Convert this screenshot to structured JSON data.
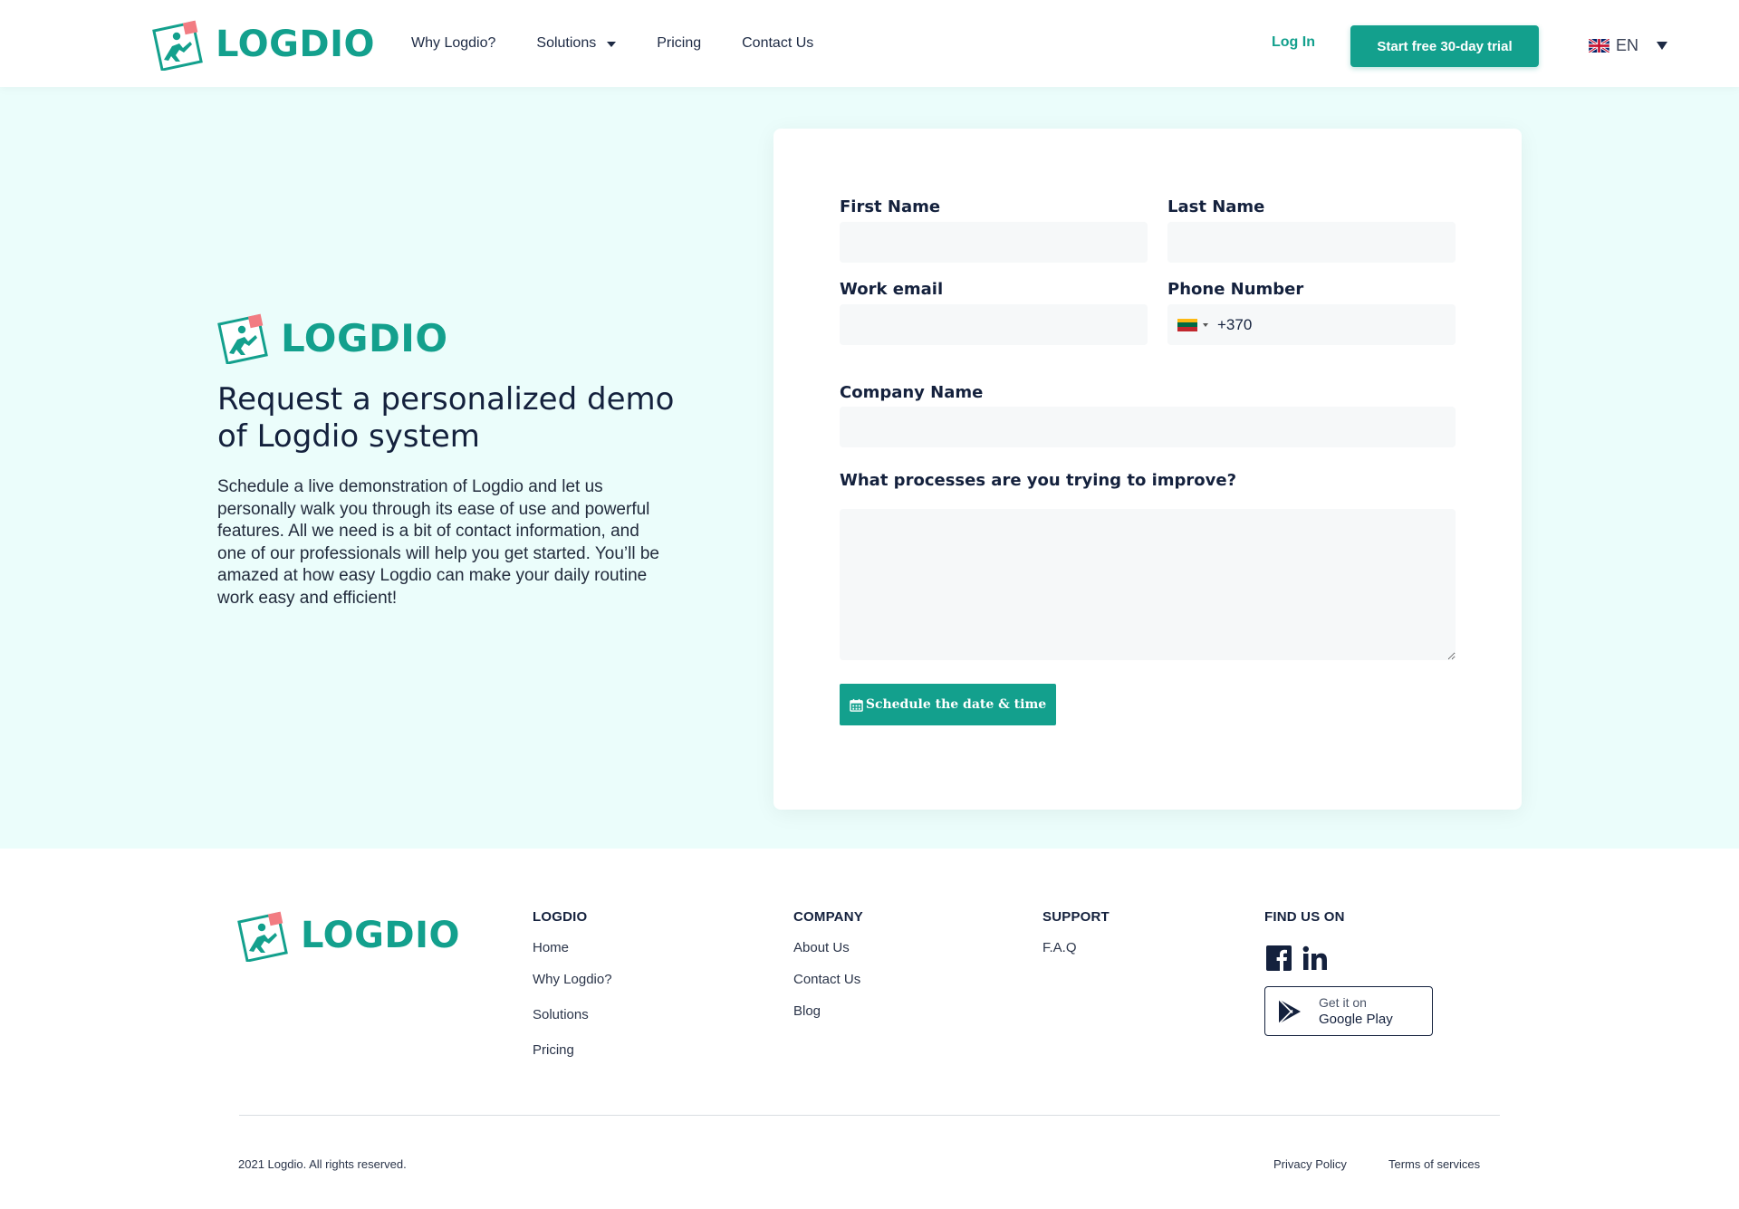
{
  "brand": {
    "name": "LOGDIO",
    "color": "#13a08d",
    "accent_color": "#f27c82"
  },
  "header": {
    "nav": [
      {
        "label": "Why Logdio?",
        "has_dropdown": false
      },
      {
        "label": "Solutions",
        "has_dropdown": true
      },
      {
        "label": "Pricing",
        "has_dropdown": false
      },
      {
        "label": "Contact Us",
        "has_dropdown": false
      }
    ],
    "login_label": "Log In",
    "trial_label": "Start free 30-day trial",
    "language": {
      "code": "EN",
      "flag_icon": "uk-flag-icon"
    }
  },
  "hero": {
    "title": "Request a personalized demo of Logdio system",
    "description": "Schedule a live demonstration of Logdio and let us personally walk you through its ease of use and powerful features. All we need is a bit of contact information, and one of our professionals will help you get started. You’ll be amazed at how easy Logdio can make your daily routine work easy and efficient!"
  },
  "form": {
    "first_name": {
      "label": "First Name",
      "value": ""
    },
    "last_name": {
      "label": "Last Name",
      "value": ""
    },
    "work_email": {
      "label": "Work email",
      "value": ""
    },
    "phone": {
      "label": "Phone Number",
      "value": "+370",
      "country_flag_icon": "lithuania-flag-icon"
    },
    "company": {
      "label": "Company Name",
      "value": ""
    },
    "processes": {
      "label": "What processes are you trying to improve?",
      "value": ""
    },
    "submit_label": "Schedule the date & time",
    "submit_icon": "calendar-icon"
  },
  "footer": {
    "columns": [
      {
        "heading": "LOGDIO",
        "links": [
          "Home",
          "Why Logdio?",
          "Solutions",
          "Pricing"
        ]
      },
      {
        "heading": "COMPANY",
        "links": [
          "About Us",
          "Contact Us",
          "Blog"
        ]
      },
      {
        "heading": "SUPPORT",
        "links": [
          "F.A.Q"
        ]
      }
    ],
    "find_us": {
      "heading": "FIND US ON",
      "social_icons": [
        "facebook-icon",
        "linkedin-icon"
      ],
      "google_play": {
        "small": "Get it on",
        "big": "Google Play"
      }
    },
    "copyright": "2021 Logdio. All rights reserved.",
    "privacy_label": "Privacy Policy",
    "terms_label": "Terms of services"
  }
}
